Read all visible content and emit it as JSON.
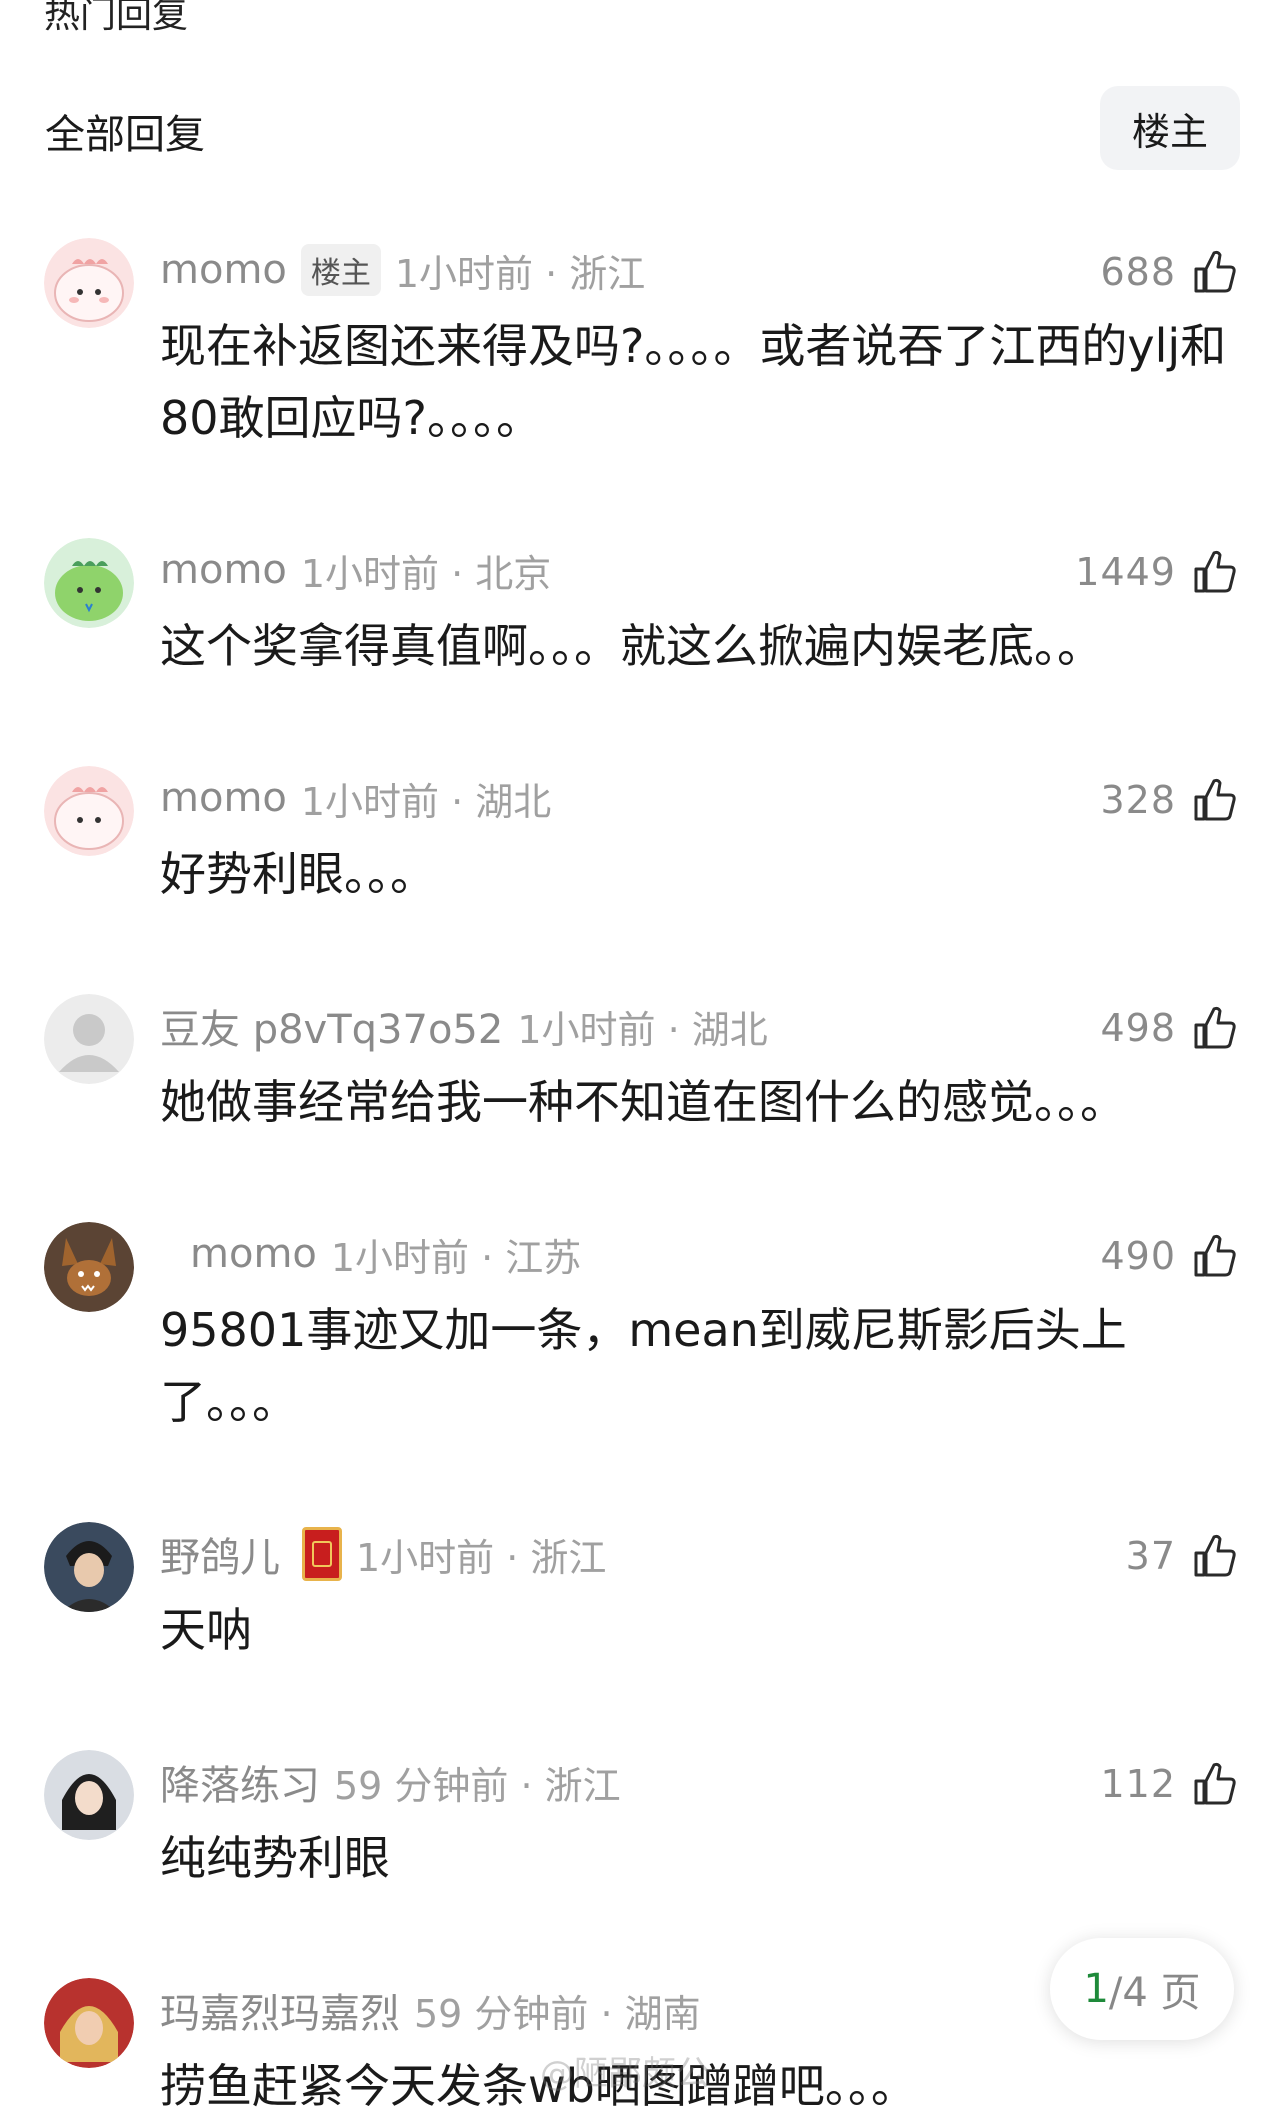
{
  "top_section_title": "热门回复",
  "all_replies": {
    "title": "全部回复",
    "op_filter_label": "楼主"
  },
  "comments": [
    {
      "username": "momo",
      "op_badge": "楼主",
      "time_loc": "1小时前 · 浙江",
      "likes": "688",
      "text": "现在补返图还来得及吗?。。。。或者说吞了江西的ylj和80敢回应吗?。。。。",
      "avatar": "pink-dino"
    },
    {
      "username": "momo",
      "time_loc": "1小时前 · 北京",
      "likes": "1449",
      "text": "这个奖拿得真值啊。。。就这么掀遍内娱老底。。",
      "avatar": "green-dino"
    },
    {
      "username": "momo",
      "time_loc": "1小时前 · 湖北",
      "likes": "328",
      "text": "好势利眼。。。",
      "avatar": "pink-dino"
    },
    {
      "username": "豆友 p8vTq37o52",
      "time_loc": "1小时前 · 湖北",
      "likes": "498",
      "text": "她做事经常给我一种不知道在图什么的感觉。。。",
      "avatar": "default-user"
    },
    {
      "username": "momo",
      "time_loc": "1小时前 · 江苏",
      "likes": "490",
      "text": "95801事迹又加一条，mean到威尼斯影后头上了。。。",
      "avatar": "bunny"
    },
    {
      "username": "野鸽儿",
      "time_loc": "1小时前 · 浙江",
      "likes": "37",
      "text": "天呐",
      "avatar": "anime-boy",
      "badge_icon": "red-badge-icon"
    },
    {
      "username": "降落练习",
      "time_loc": "59 分钟前 · 浙江",
      "likes": "112",
      "text": "纯纯势利眼",
      "avatar": "girl-photo"
    },
    {
      "username": "玛嘉烈玛嘉烈",
      "time_loc": "59 分钟前 · 湖南",
      "likes": "",
      "text": "捞鱼赶紧今天发条wb晒图蹭蹭吧。。。",
      "avatar": "blonde-photo"
    }
  ],
  "pagination": {
    "current": "1",
    "rest": "/4 页"
  },
  "watermark": "@陋鄙颇公",
  "colors": {
    "accent_green": "#1e8a3a",
    "meta_gray": "#a0a0a0"
  }
}
